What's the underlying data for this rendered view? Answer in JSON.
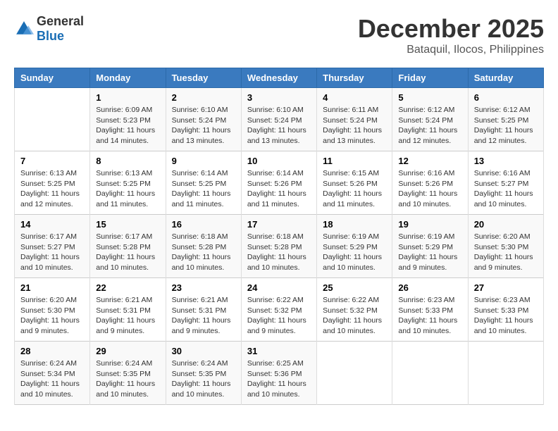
{
  "logo": {
    "general": "General",
    "blue": "Blue"
  },
  "title": "December 2025",
  "location": "Bataquil, Ilocos, Philippines",
  "headers": [
    "Sunday",
    "Monday",
    "Tuesday",
    "Wednesday",
    "Thursday",
    "Friday",
    "Saturday"
  ],
  "weeks": [
    [
      {
        "day": "",
        "info": ""
      },
      {
        "day": "1",
        "info": "Sunrise: 6:09 AM\nSunset: 5:23 PM\nDaylight: 11 hours\nand 14 minutes."
      },
      {
        "day": "2",
        "info": "Sunrise: 6:10 AM\nSunset: 5:24 PM\nDaylight: 11 hours\nand 13 minutes."
      },
      {
        "day": "3",
        "info": "Sunrise: 6:10 AM\nSunset: 5:24 PM\nDaylight: 11 hours\nand 13 minutes."
      },
      {
        "day": "4",
        "info": "Sunrise: 6:11 AM\nSunset: 5:24 PM\nDaylight: 11 hours\nand 13 minutes."
      },
      {
        "day": "5",
        "info": "Sunrise: 6:12 AM\nSunset: 5:24 PM\nDaylight: 11 hours\nand 12 minutes."
      },
      {
        "day": "6",
        "info": "Sunrise: 6:12 AM\nSunset: 5:25 PM\nDaylight: 11 hours\nand 12 minutes."
      }
    ],
    [
      {
        "day": "7",
        "info": "Sunrise: 6:13 AM\nSunset: 5:25 PM\nDaylight: 11 hours\nand 12 minutes."
      },
      {
        "day": "8",
        "info": "Sunrise: 6:13 AM\nSunset: 5:25 PM\nDaylight: 11 hours\nand 11 minutes."
      },
      {
        "day": "9",
        "info": "Sunrise: 6:14 AM\nSunset: 5:25 PM\nDaylight: 11 hours\nand 11 minutes."
      },
      {
        "day": "10",
        "info": "Sunrise: 6:14 AM\nSunset: 5:26 PM\nDaylight: 11 hours\nand 11 minutes."
      },
      {
        "day": "11",
        "info": "Sunrise: 6:15 AM\nSunset: 5:26 PM\nDaylight: 11 hours\nand 11 minutes."
      },
      {
        "day": "12",
        "info": "Sunrise: 6:16 AM\nSunset: 5:26 PM\nDaylight: 11 hours\nand 10 minutes."
      },
      {
        "day": "13",
        "info": "Sunrise: 6:16 AM\nSunset: 5:27 PM\nDaylight: 11 hours\nand 10 minutes."
      }
    ],
    [
      {
        "day": "14",
        "info": "Sunrise: 6:17 AM\nSunset: 5:27 PM\nDaylight: 11 hours\nand 10 minutes."
      },
      {
        "day": "15",
        "info": "Sunrise: 6:17 AM\nSunset: 5:28 PM\nDaylight: 11 hours\nand 10 minutes."
      },
      {
        "day": "16",
        "info": "Sunrise: 6:18 AM\nSunset: 5:28 PM\nDaylight: 11 hours\nand 10 minutes."
      },
      {
        "day": "17",
        "info": "Sunrise: 6:18 AM\nSunset: 5:28 PM\nDaylight: 11 hours\nand 10 minutes."
      },
      {
        "day": "18",
        "info": "Sunrise: 6:19 AM\nSunset: 5:29 PM\nDaylight: 11 hours\nand 10 minutes."
      },
      {
        "day": "19",
        "info": "Sunrise: 6:19 AM\nSunset: 5:29 PM\nDaylight: 11 hours\nand 9 minutes."
      },
      {
        "day": "20",
        "info": "Sunrise: 6:20 AM\nSunset: 5:30 PM\nDaylight: 11 hours\nand 9 minutes."
      }
    ],
    [
      {
        "day": "21",
        "info": "Sunrise: 6:20 AM\nSunset: 5:30 PM\nDaylight: 11 hours\nand 9 minutes."
      },
      {
        "day": "22",
        "info": "Sunrise: 6:21 AM\nSunset: 5:31 PM\nDaylight: 11 hours\nand 9 minutes."
      },
      {
        "day": "23",
        "info": "Sunrise: 6:21 AM\nSunset: 5:31 PM\nDaylight: 11 hours\nand 9 minutes."
      },
      {
        "day": "24",
        "info": "Sunrise: 6:22 AM\nSunset: 5:32 PM\nDaylight: 11 hours\nand 9 minutes."
      },
      {
        "day": "25",
        "info": "Sunrise: 6:22 AM\nSunset: 5:32 PM\nDaylight: 11 hours\nand 10 minutes."
      },
      {
        "day": "26",
        "info": "Sunrise: 6:23 AM\nSunset: 5:33 PM\nDaylight: 11 hours\nand 10 minutes."
      },
      {
        "day": "27",
        "info": "Sunrise: 6:23 AM\nSunset: 5:33 PM\nDaylight: 11 hours\nand 10 minutes."
      }
    ],
    [
      {
        "day": "28",
        "info": "Sunrise: 6:24 AM\nSunset: 5:34 PM\nDaylight: 11 hours\nand 10 minutes."
      },
      {
        "day": "29",
        "info": "Sunrise: 6:24 AM\nSunset: 5:35 PM\nDaylight: 11 hours\nand 10 minutes."
      },
      {
        "day": "30",
        "info": "Sunrise: 6:24 AM\nSunset: 5:35 PM\nDaylight: 11 hours\nand 10 minutes."
      },
      {
        "day": "31",
        "info": "Sunrise: 6:25 AM\nSunset: 5:36 PM\nDaylight: 11 hours\nand 10 minutes."
      },
      {
        "day": "",
        "info": ""
      },
      {
        "day": "",
        "info": ""
      },
      {
        "day": "",
        "info": ""
      }
    ]
  ]
}
